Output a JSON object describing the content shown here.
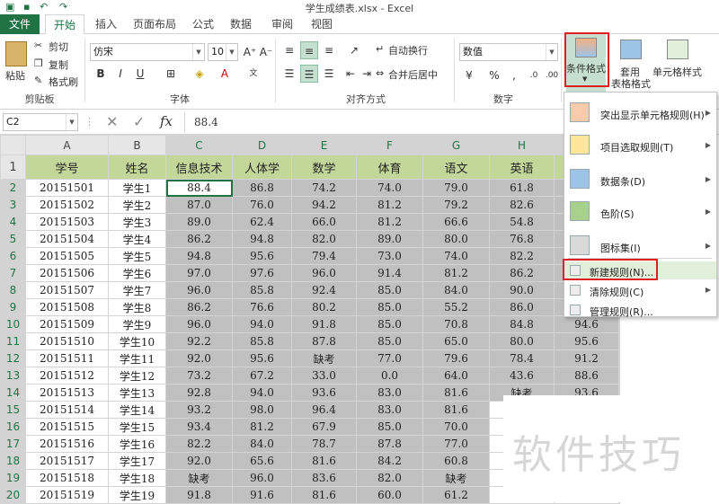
{
  "window": {
    "title": "学生成绩表.xlsx - Excel"
  },
  "tabs": [
    {
      "label": "文件"
    },
    {
      "label": "开始"
    },
    {
      "label": "插入"
    },
    {
      "label": "页面布局"
    },
    {
      "label": "公式"
    },
    {
      "label": "数据"
    },
    {
      "label": "审阅"
    },
    {
      "label": "视图"
    }
  ],
  "ribbon": {
    "paste": "粘贴",
    "cut": "剪切",
    "copy": "复制",
    "format_painter": "格式刷",
    "clipboard_group": "剪贴板",
    "font_name": "仿宋",
    "font_size": "10",
    "font_group": "字体",
    "bold": "B",
    "italic": "I",
    "underline": "U",
    "wrap_text": "自动换行",
    "merge_center": "合并后居中",
    "alignment_group": "对齐方式",
    "number_format": "数值",
    "number_group": "数字",
    "percent": "%",
    "comma": ",",
    "conditional_format": "条件格式",
    "format_as_table_1": "套用",
    "format_as_table_2": "表格格式",
    "cell_styles": "单元格样式"
  },
  "formula_bar": {
    "name_box": "C2",
    "cancel": "✕",
    "enter": "✓",
    "fx": "fx",
    "value": "88.4"
  },
  "columns": [
    "A",
    "B",
    "C",
    "D",
    "E",
    "F",
    "G",
    "H",
    "I"
  ],
  "header_row": [
    "学号",
    "姓名",
    "信息技术",
    "人体学",
    "数学",
    "体育",
    "语文",
    "英语",
    ""
  ],
  "rows": [
    [
      "20151501",
      "学生1",
      "88.4",
      "86.8",
      "74.2",
      "74.0",
      "79.0",
      "61.8",
      ""
    ],
    [
      "20151502",
      "学生2",
      "87.0",
      "76.0",
      "94.2",
      "81.2",
      "79.2",
      "82.6",
      ""
    ],
    [
      "20151503",
      "学生3",
      "89.0",
      "62.4",
      "66.0",
      "81.2",
      "66.6",
      "54.8",
      ""
    ],
    [
      "20151504",
      "学生4",
      "86.2",
      "94.8",
      "82.0",
      "89.0",
      "80.0",
      "76.8",
      ""
    ],
    [
      "20151505",
      "学生5",
      "94.8",
      "95.6",
      "79.4",
      "73.0",
      "74.0",
      "82.2",
      ""
    ],
    [
      "20151506",
      "学生6",
      "97.0",
      "97.6",
      "96.0",
      "91.4",
      "81.2",
      "86.2",
      ""
    ],
    [
      "20151507",
      "学生7",
      "96.0",
      "85.8",
      "92.4",
      "85.0",
      "84.0",
      "90.0",
      ""
    ],
    [
      "20151508",
      "学生8",
      "86.2",
      "76.6",
      "80.2",
      "85.0",
      "55.2",
      "86.0",
      ""
    ],
    [
      "20151509",
      "学生9",
      "96.0",
      "94.0",
      "91.8",
      "85.0",
      "70.8",
      "84.8",
      "94.6"
    ],
    [
      "20151510",
      "学生10",
      "92.2",
      "85.8",
      "87.8",
      "85.0",
      "65.0",
      "80.0",
      "95.6"
    ],
    [
      "20151511",
      "学生11",
      "92.0",
      "95.6",
      "缺考",
      "77.0",
      "79.6",
      "78.4",
      "91.2"
    ],
    [
      "20151512",
      "学生12",
      "73.2",
      "67.2",
      "33.0",
      "0.0",
      "64.0",
      "43.6",
      "88.6"
    ],
    [
      "20151513",
      "学生13",
      "92.8",
      "94.0",
      "93.6",
      "83.0",
      "81.6",
      "缺考",
      "93.6"
    ],
    [
      "20151514",
      "学生14",
      "93.2",
      "98.0",
      "96.4",
      "83.0",
      "81.6",
      "",
      ""
    ],
    [
      "20151515",
      "学生15",
      "93.4",
      "81.2",
      "67.9",
      "85.0",
      "70.0",
      "",
      ""
    ],
    [
      "20151516",
      "学生16",
      "82.2",
      "84.0",
      "78.7",
      "87.8",
      "77.0",
      "",
      ""
    ],
    [
      "20151517",
      "学生17",
      "92.0",
      "65.6",
      "81.6",
      "84.2",
      "60.8",
      "",
      ""
    ],
    [
      "20151518",
      "学生18",
      "缺考",
      "96.0",
      "83.6",
      "82.0",
      "缺考",
      "",
      ""
    ],
    [
      "20151519",
      "学生19",
      "91.8",
      "91.6",
      "81.6",
      "60.0",
      "61.2",
      "",
      ""
    ]
  ],
  "row_numbers": [
    "1",
    "2",
    "3",
    "4",
    "5",
    "6",
    "7",
    "8",
    "9",
    "10",
    "11",
    "12",
    "13",
    "14",
    "15",
    "16",
    "17",
    "18",
    "19",
    "20"
  ],
  "cf_menu": [
    {
      "label": "突出显示单元格规则(H)",
      "submenu": true
    },
    {
      "label": "项目选取规则(T)",
      "submenu": true
    },
    {
      "label": "数据条(D)",
      "submenu": true
    },
    {
      "label": "色阶(S)",
      "submenu": true
    },
    {
      "label": "图标集(I)",
      "submenu": true
    },
    {
      "label": "新建规则(N)...",
      "submenu": false
    },
    {
      "label": "清除规则(C)",
      "submenu": true
    },
    {
      "label": "管理规则(R)...",
      "submenu": false
    }
  ],
  "watermark": "软件技巧",
  "colors": {
    "accent": "#217346",
    "header_fill": "#c4d79b",
    "highlight": "#e02020"
  }
}
